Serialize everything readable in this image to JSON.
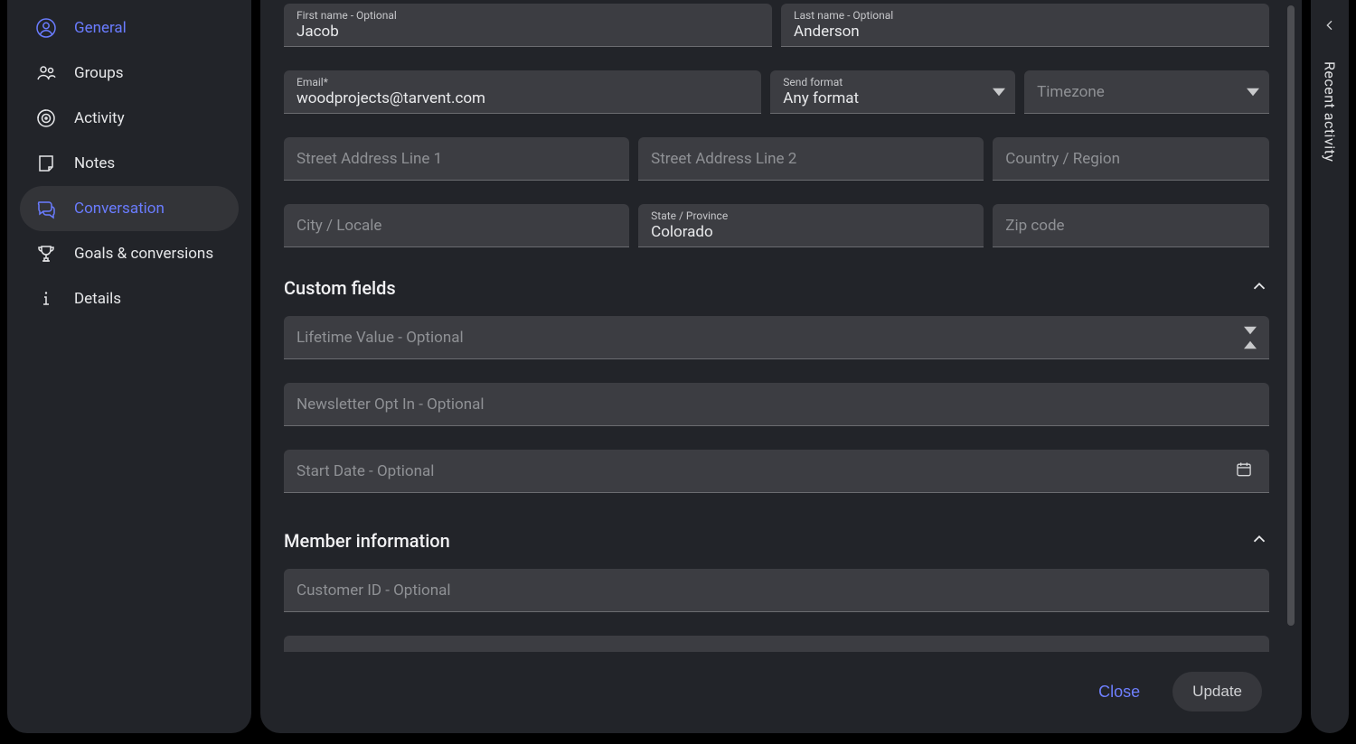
{
  "sidebar": {
    "items": [
      {
        "label": "General"
      },
      {
        "label": "Groups"
      },
      {
        "label": "Activity"
      },
      {
        "label": "Notes"
      },
      {
        "label": "Conversation"
      },
      {
        "label": "Goals & conversions"
      },
      {
        "label": "Details"
      }
    ]
  },
  "form": {
    "first_name": {
      "label": "First name - Optional",
      "value": "Jacob"
    },
    "last_name": {
      "label": "Last name - Optional",
      "value": "Anderson"
    },
    "email": {
      "label": "Email*",
      "value": "woodprojects@tarvent.com"
    },
    "send_format": {
      "label": "Send format",
      "value": "Any format"
    },
    "timezone": {
      "placeholder": "Timezone"
    },
    "street1": {
      "placeholder": "Street Address Line 1"
    },
    "street2": {
      "placeholder": "Street Address Line 2"
    },
    "country": {
      "placeholder": "Country / Region"
    },
    "city": {
      "placeholder": "City / Locale"
    },
    "state": {
      "label": "State / Province",
      "value": "Colorado"
    },
    "zip": {
      "placeholder": "Zip code"
    }
  },
  "custom_fields": {
    "title": "Custom fields",
    "lifetime_value": {
      "placeholder": "Lifetime Value - Optional"
    },
    "newsletter_opt_in": {
      "placeholder": "Newsletter Opt In - Optional"
    },
    "start_date": {
      "placeholder": "Start Date - Optional"
    }
  },
  "member_info": {
    "title": "Member information",
    "customer_id": {
      "placeholder": "Customer ID - Optional"
    }
  },
  "activity_panel": {
    "label": "Recent activity"
  },
  "footer": {
    "close": "Close",
    "update": "Update"
  }
}
